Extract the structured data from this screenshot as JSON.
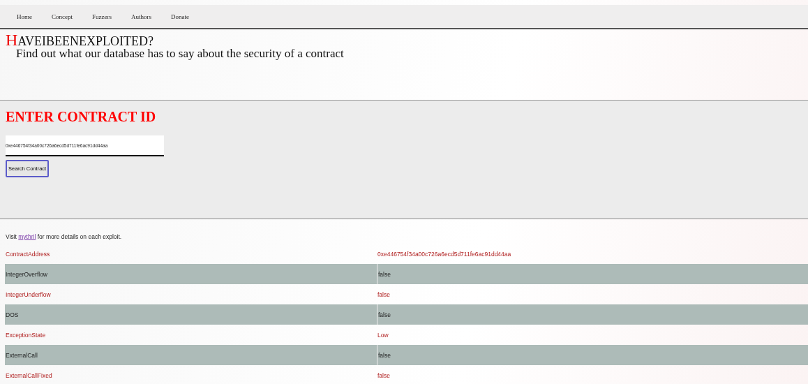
{
  "nav": [
    "Home",
    "Concept",
    "Fuzzers",
    "Authors",
    "Donate"
  ],
  "header": {
    "title_initial": "H",
    "title_rest": "AVEIBEENEXPLOITED?",
    "subtitle": "Find out what our database has to say about the security of a contract"
  },
  "search": {
    "heading": "ENTER CONTRACT ID",
    "value": "0xe446754f34a00c726a6ecd5d711fe6ac91dd44aa",
    "button": "Search Contract"
  },
  "note": {
    "before": "Visit ",
    "link": "mythril",
    "after": " for more details on each exploit."
  },
  "table": {
    "rows": [
      {
        "name": "ContractAddress",
        "value": "0xe446754f34a00c726a6ecd5d711fe6ac91dd44aa"
      },
      {
        "name": "IntegerOverflow",
        "value": "false"
      },
      {
        "name": "IntegerUnderflow",
        "value": "false"
      },
      {
        "name": "DOS",
        "value": "false"
      },
      {
        "name": "ExceptionState",
        "value": "Low"
      },
      {
        "name": "ExternalCall",
        "value": "false"
      },
      {
        "name": "ExternalCallFixed",
        "value": "false"
      }
    ]
  }
}
